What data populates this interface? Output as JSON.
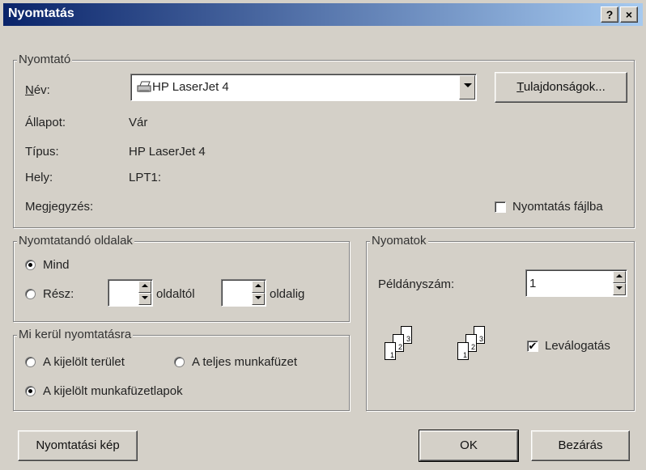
{
  "window": {
    "title": "Nyomtatás",
    "help_label": "?",
    "close_label": "×"
  },
  "printer": {
    "group_label": "Nyomtató",
    "name_label": "Név:",
    "name_value": "HP LaserJet 4",
    "properties_label": "Tulajdonságok...",
    "status_label": "Állapot:",
    "status_value": "Vár",
    "type_label": "Típus:",
    "type_value": "HP LaserJet 4",
    "location_label": "Hely:",
    "location_value": "LPT1:",
    "comment_label": "Megjegyzés:",
    "print_to_file_label": "Nyomtatás fájlba",
    "print_to_file_checked": false
  },
  "pages": {
    "group_label": "Nyomtatandó oldalak",
    "all_label": "Mind",
    "range_label": "Rész:",
    "from_value": "",
    "from_label": "oldaltól",
    "to_value": "",
    "to_label": "oldalig",
    "selected": "all"
  },
  "what": {
    "group_label": "Mi kerül nyomtatásra",
    "selection_label": "A kijelölt terület",
    "workbook_label": "A teljes munkafüzet",
    "sheets_label": "A kijelölt munkafüzetlapok",
    "selected": "sheets"
  },
  "copies": {
    "group_label": "Nyomatok",
    "count_label": "Példányszám:",
    "count_value": "1",
    "collate_label": "Leválogatás",
    "collate_checked": true,
    "sheet_numbers": [
      "1",
      "2",
      "3"
    ]
  },
  "buttons": {
    "preview": "Nyomtatási kép",
    "ok": "OK",
    "close": "Bezárás"
  },
  "icons": [
    "printer-icon",
    "collate-pages-icon"
  ]
}
